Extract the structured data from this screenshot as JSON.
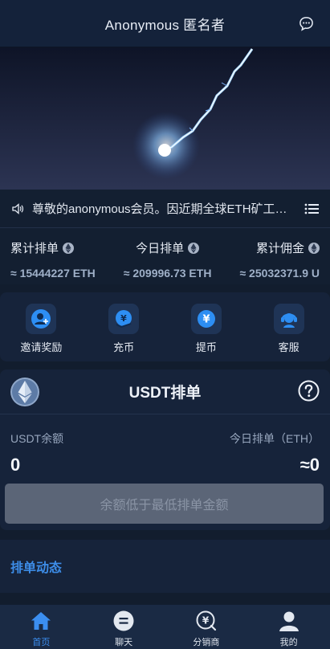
{
  "header": {
    "title": "Anonymous 匿名者",
    "chat_icon": "chat-bubble-icon"
  },
  "notice": {
    "text": "尊敬的anonymous会员。因近期全球ETH矿工…",
    "speaker_icon": "speaker-icon",
    "list_icon": "list-icon"
  },
  "stats": [
    {
      "label": "累计排单",
      "value": "≈ 15444227 ETH"
    },
    {
      "label": "今日排单",
      "value": "≈ 209996.73 ETH"
    },
    {
      "label": "累计佣金",
      "value": "≈ 25032371.9 U"
    }
  ],
  "actions": [
    {
      "label": "邀请奖励",
      "icon": "invite-user-icon"
    },
    {
      "label": "充币",
      "icon": "deposit-coin-icon"
    },
    {
      "label": "提币",
      "icon": "withdraw-coin-icon"
    },
    {
      "label": "客服",
      "icon": "customer-service-icon"
    }
  ],
  "usdt": {
    "title": "USDT排单",
    "balance_label": "USDT余额",
    "balance_value": "0",
    "today_label": "今日排单（ETH）",
    "today_value": "≈0",
    "button_label": "余额低于最低排单金额"
  },
  "dynamics": {
    "title": "排单动态"
  },
  "tabs": [
    {
      "label": "首页",
      "icon": "home-icon",
      "active": true
    },
    {
      "label": "聊天",
      "icon": "chat-icon",
      "active": false
    },
    {
      "label": "分销商",
      "icon": "distributor-icon",
      "active": false
    },
    {
      "label": "我的",
      "icon": "profile-icon",
      "active": false
    }
  ],
  "colors": {
    "accent": "#3b8ef0",
    "background": "#121d2e",
    "card": "#16233a",
    "button_disabled": "#5b6577"
  }
}
